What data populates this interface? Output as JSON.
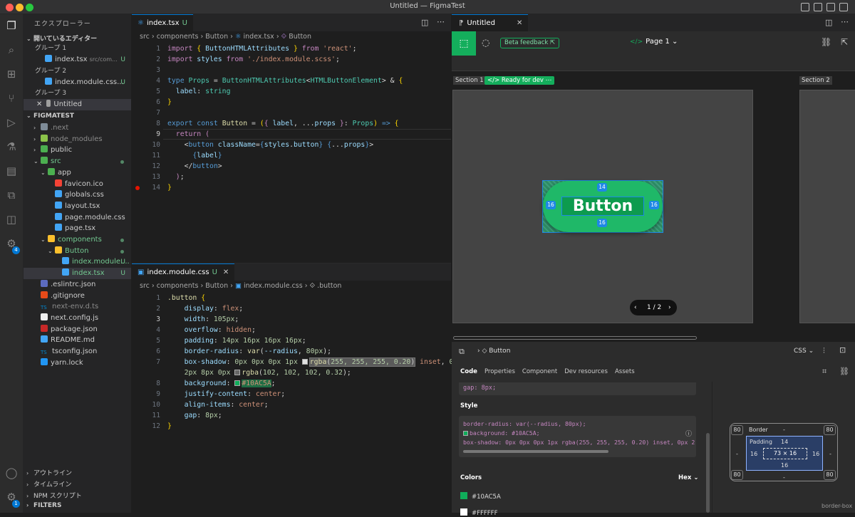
{
  "window": {
    "title": "Untitled — FigmaTest"
  },
  "sidebar": {
    "title": "エクスプローラー",
    "open_editors": "開いているエディター",
    "groups": [
      {
        "label": "グループ 1",
        "file": "index.tsx",
        "path": "src/com...",
        "git": "U"
      },
      {
        "label": "グループ 2",
        "file": "index.module.css...",
        "git": "U"
      },
      {
        "label": "グループ 3",
        "file": "Untitled"
      }
    ],
    "project": "FIGMATEST",
    "tree": [
      {
        "name": ".next",
        "indent": 1,
        "arrow": "›",
        "color": "#8b8b8b",
        "icon": "#7e8b97"
      },
      {
        "name": "node_modules",
        "indent": 1,
        "arrow": "›",
        "color": "#8b8b8b",
        "icon": "#8bc34a"
      },
      {
        "name": "public",
        "indent": 1,
        "arrow": "›",
        "color": "#cccccc",
        "icon": "#4caf50"
      },
      {
        "name": "src",
        "indent": 1,
        "arrow": "⌄",
        "color": "#73c991",
        "icon": "#4caf50",
        "dot": true
      },
      {
        "name": "app",
        "indent": 2,
        "arrow": "⌄",
        "color": "#cccccc",
        "icon": "#4caf50"
      },
      {
        "name": "favicon.ico",
        "indent": 3,
        "color": "#cccccc",
        "icon": "#f44336"
      },
      {
        "name": "globals.css",
        "indent": 3,
        "color": "#cccccc",
        "icon": "#42a5f5"
      },
      {
        "name": "layout.tsx",
        "indent": 3,
        "color": "#cccccc",
        "icon": "#42a5f5"
      },
      {
        "name": "page.module.css",
        "indent": 3,
        "color": "#cccccc",
        "icon": "#42a5f5"
      },
      {
        "name": "page.tsx",
        "indent": 3,
        "color": "#cccccc",
        "icon": "#42a5f5"
      },
      {
        "name": "components",
        "indent": 2,
        "arrow": "⌄",
        "color": "#73c991",
        "icon": "#fbc02d",
        "dot": true
      },
      {
        "name": "Button",
        "indent": 3,
        "arrow": "⌄",
        "color": "#73c991",
        "icon": "#fbc02d",
        "dot": true
      },
      {
        "name": "index.module....",
        "indent": 4,
        "color": "#73c991",
        "icon": "#42a5f5",
        "git": "U"
      },
      {
        "name": "index.tsx",
        "indent": 4,
        "color": "#73c991",
        "icon": "#42a5f5",
        "git": "U",
        "sel": true
      },
      {
        "name": ".eslintrc.json",
        "indent": 1,
        "color": "#cccccc",
        "icon": "#5c6bc0"
      },
      {
        "name": ".gitignore",
        "indent": 1,
        "color": "#cccccc",
        "icon": "#e64a19"
      },
      {
        "name": "next-env.d.ts",
        "indent": 1,
        "color": "#8b8b8b",
        "icon": "#0288d1",
        "iconText": "TS"
      },
      {
        "name": "next.config.js",
        "indent": 1,
        "color": "#cccccc",
        "icon": "#eeeeee"
      },
      {
        "name": "package.json",
        "indent": 1,
        "color": "#cccccc",
        "icon": "#c62828"
      },
      {
        "name": "README.md",
        "indent": 1,
        "color": "#cccccc",
        "icon": "#42a5f5"
      },
      {
        "name": "tsconfig.json",
        "indent": 1,
        "color": "#cccccc",
        "icon": "#0288d1",
        "iconText": "TS"
      },
      {
        "name": "yarn.lock",
        "indent": 1,
        "color": "#cccccc",
        "icon": "#2196f3"
      }
    ],
    "bottom": [
      "アウトライン",
      "タイムライン",
      "NPM スクリプト",
      "FILTERS"
    ]
  },
  "editor_top": {
    "tab": "index.tsx",
    "tab_git": "U",
    "breadcrumb": [
      "src",
      "components",
      "Button",
      "index.tsx",
      "Button"
    ]
  },
  "editor_bottom": {
    "tab": "index.module.css",
    "tab_git": "U",
    "breadcrumb": [
      "src",
      "components",
      "Button",
      "index.module.css",
      ".button"
    ]
  },
  "figma": {
    "tab": "Untitled",
    "beta": "Beta feedback",
    "page": "Page 1",
    "section1": "Section 1",
    "ready": "Ready for dev",
    "section2": "Section 2",
    "button_label": "Button",
    "pad_top": "14",
    "pad_left": "16",
    "pad_right": "16",
    "pad_bottom": "16",
    "pager": "1 / 2",
    "inspect_title": "Button",
    "lang": "CSS",
    "tabs": [
      "Code",
      "Properties",
      "Component",
      "Dev resources",
      "Assets"
    ],
    "code_gap": "gap: 8px;",
    "style_label": "Style",
    "style_lines": [
      "border-radius: var(--radius, 80px);",
      "background: #10AC5A;",
      "box-shadow: 0px 0px 0px 1px rgba(255, 255, 255, 0.20) inset, 0px 2"
    ],
    "colors_label": "Colors",
    "hex": "Hex",
    "colors": [
      {
        "hex": "#10AC5A",
        "swatch": "#10AC5A"
      },
      {
        "hex": "#FFFFFF",
        "swatch": "#FFFFFF"
      }
    ],
    "box": {
      "border_label": "Border",
      "padding_label": "Padding",
      "radius": "80",
      "pad_top": "14",
      "pad_left": "16",
      "pad_right": "16",
      "pad_bottom": "16",
      "size": "73 × 16",
      "dash": "-",
      "sizing": "border-box"
    }
  }
}
